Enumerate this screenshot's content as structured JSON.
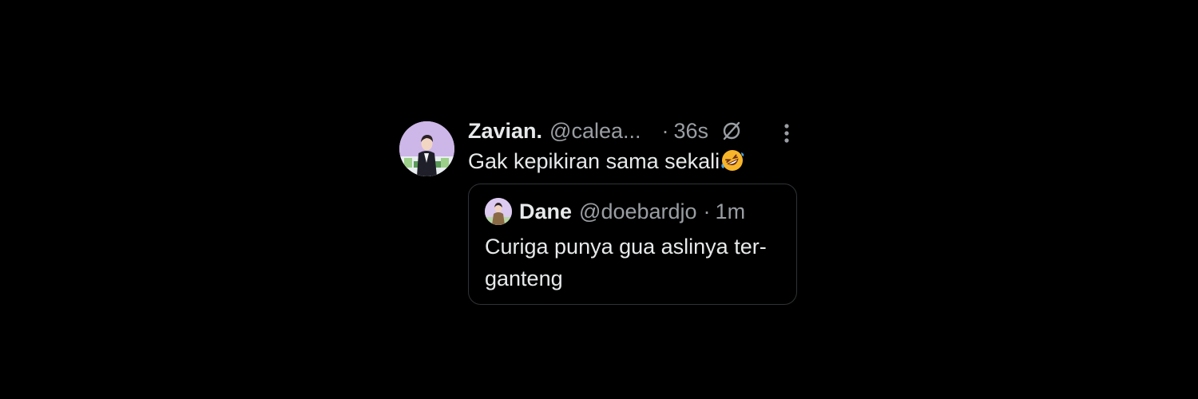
{
  "tweet": {
    "author": {
      "display_name": "Zavian.",
      "handle": "@calea...",
      "avatar_icon": "profile-photo-man-in-suit"
    },
    "separator": "·",
    "time": "36s",
    "grok_icon": "grok-icon",
    "more_icon": "more-dots-icon",
    "text": "Gak kepikiran sama sekali",
    "emoji": "rolling-on-the-floor-laughing-emoji",
    "quoted": {
      "author": {
        "display_name": "Dane",
        "handle": "@doebardjo",
        "avatar_icon": "profile-photo-small"
      },
      "separator": "·",
      "time": "1m",
      "text": "Curiga punya gua aslinya ter-ganteng"
    }
  },
  "colors": {
    "background": "#000000",
    "primary_text": "#e7e9ea",
    "secondary_text": "#9a9ea3",
    "border": "#2f3336"
  }
}
